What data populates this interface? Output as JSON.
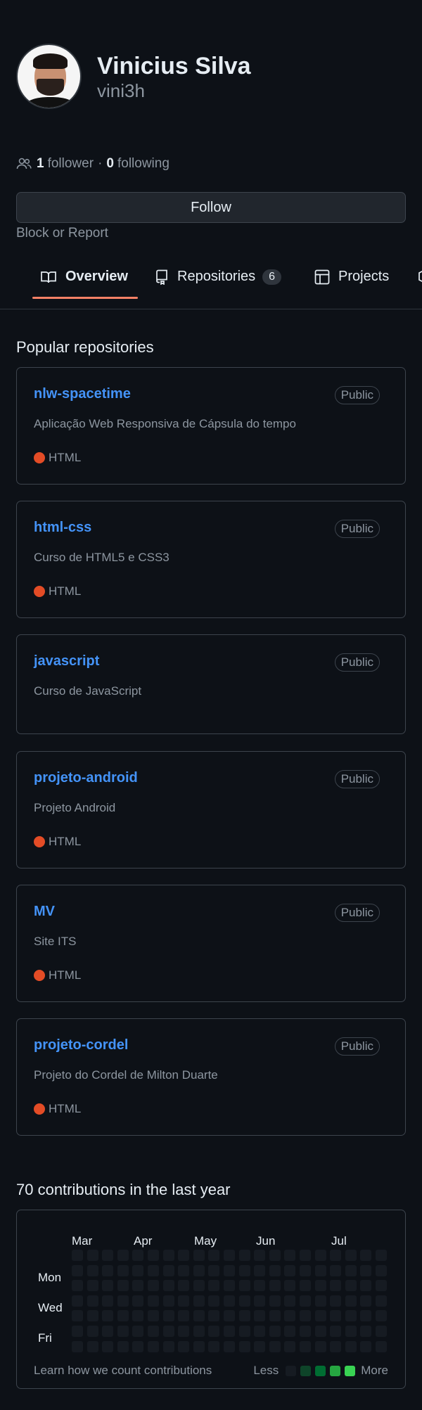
{
  "profile": {
    "fullname": "Vinicius Silva",
    "username": "vini3h",
    "followers_count": "1",
    "followers_label": "follower",
    "separator": "·",
    "following_count": "0",
    "following_label": "following",
    "follow_button": "Follow",
    "block_report": "Block or Report"
  },
  "tabs": [
    {
      "label": "Overview",
      "icon": "book-icon",
      "active": true
    },
    {
      "label": "Repositories",
      "icon": "repo-icon",
      "count": "6"
    },
    {
      "label": "Projects",
      "icon": "table-icon"
    }
  ],
  "popular": {
    "title": "Popular repositories",
    "repos": [
      {
        "name": "nlw-spacetime",
        "visibility": "Public",
        "description": "Aplicação Web Responsiva de Cápsula do tempo",
        "language": "HTML"
      },
      {
        "name": "html-css",
        "visibility": "Public",
        "description": "Curso de HTML5 e CSS3",
        "language": "HTML"
      },
      {
        "name": "javascript",
        "visibility": "Public",
        "description": "Curso de JavaScript",
        "language": ""
      },
      {
        "name": "projeto-android",
        "visibility": "Public",
        "description": "Projeto Android",
        "language": "HTML"
      },
      {
        "name": "MV",
        "visibility": "Public",
        "description": "Site ITS",
        "language": "HTML"
      },
      {
        "name": "projeto-cordel",
        "visibility": "Public",
        "description": "Projeto do Cordel de Milton Duarte",
        "language": "HTML"
      }
    ]
  },
  "contributions": {
    "title": "70 contributions in the last year",
    "months": [
      "Mar",
      "Apr",
      "May",
      "Jun",
      "Jul"
    ],
    "days": [
      "Mon",
      "Wed",
      "Fri"
    ],
    "footer": "Learn how we count contributions",
    "legend_less": "Less",
    "legend_more": "More",
    "legend_colors": [
      "#161b22",
      "#0e4429",
      "#006d32",
      "#26a641",
      "#39d353"
    ]
  },
  "colors": {
    "background": "#0d1117",
    "link": "#4493f8",
    "active_tab_underline": "#f78166",
    "html_language": "#e34c26"
  }
}
